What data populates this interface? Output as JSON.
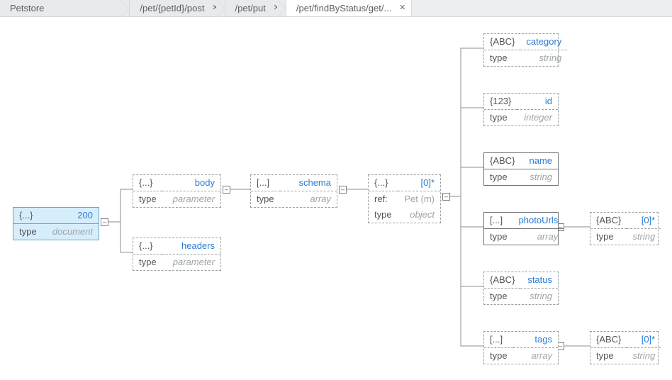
{
  "tabs": {
    "t0": "Petstore",
    "t1": "/pet/{petId}/post",
    "t2": "/pet/put",
    "t3": "/pet/findByStatus/get/..."
  },
  "labels": {
    "type": "type",
    "ref": "ref:"
  },
  "kinds": {
    "obj": "{...}",
    "arr": "[...]",
    "abc": "{ABC}",
    "num": "{123}"
  },
  "root": {
    "title": "200",
    "typeval": "document"
  },
  "body": {
    "title": "body",
    "typeval": "parameter"
  },
  "headers": {
    "title": "headers",
    "typeval": "parameter"
  },
  "schema": {
    "title": "schema",
    "typeval": "array"
  },
  "pet": {
    "title": "[0]*",
    "refval": "Pet (m)",
    "typeval": "object"
  },
  "category": {
    "title": "category",
    "typeval": "string"
  },
  "id": {
    "title": "id",
    "typeval": "integer"
  },
  "name": {
    "title": "name",
    "typeval": "string"
  },
  "photoUrls": {
    "title": "photoUrls",
    "typeval": "array"
  },
  "status": {
    "title": "status",
    "typeval": "string"
  },
  "tags": {
    "title": "tags",
    "typeval": "array"
  },
  "photo0": {
    "title": "[0]*",
    "typeval": "string"
  },
  "tag0": {
    "title": "[0]*",
    "typeval": "string"
  }
}
